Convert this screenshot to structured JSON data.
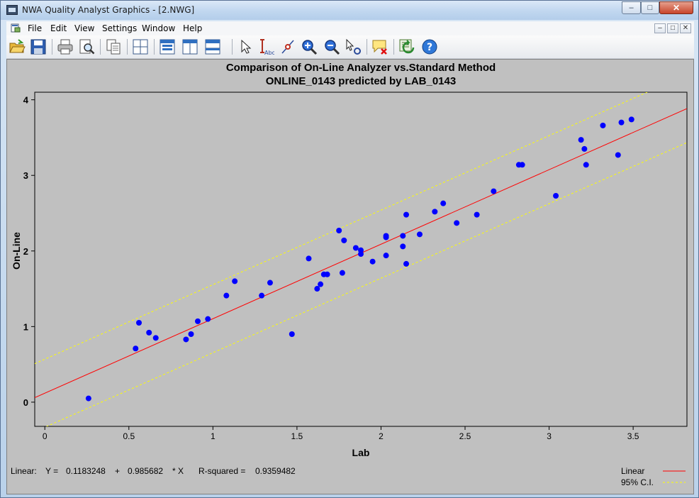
{
  "window": {
    "title": "NWA Quality Analyst Graphics - [2.NWG]",
    "buttons": {
      "minimize": "–",
      "maximize": "□",
      "close": "✕"
    }
  },
  "menu": {
    "items": [
      "File",
      "Edit",
      "View",
      "Settings",
      "Window",
      "Help"
    ],
    "mdi_buttons": [
      "–",
      "□",
      "✕"
    ]
  },
  "toolbar": {
    "icons": [
      "open-icon",
      "save-icon",
      "print-icon",
      "print-preview-icon",
      "copy-icon",
      "grid-layout-icon",
      "panes-layout-icon",
      "columns-layout-icon",
      "rows-layout-icon",
      "select-arrow-icon",
      "text-tool-icon",
      "point-marker-icon",
      "zoom-in-icon",
      "zoom-out-icon",
      "point-select-icon",
      "delete-annotation-icon",
      "refresh-icon",
      "help-icon"
    ]
  },
  "colors": {
    "plot_background": "#c0c0c0",
    "points": "#0000ff",
    "fit_line": "#ff0000",
    "ci_line": "#ffff00"
  },
  "chart_data": {
    "type": "scatter",
    "title": "Comparison of On-Line Analyzer vs.Standard Method",
    "subtitle": "ONLINE_0143 predicted by LAB_0143",
    "xlabel": "Lab",
    "ylabel": "On-Line",
    "xlim": [
      -0.06,
      3.82
    ],
    "ylim": [
      -0.32,
      4.1
    ],
    "xticks": [
      0,
      0.5,
      1,
      1.5,
      2,
      2.5,
      3,
      3.5
    ],
    "yticks": [
      0,
      1,
      2,
      3,
      4
    ],
    "grid": false,
    "points": [
      [
        0.26,
        0.05
      ],
      [
        0.54,
        0.71
      ],
      [
        0.56,
        1.05
      ],
      [
        0.62,
        0.92
      ],
      [
        0.66,
        0.85
      ],
      [
        0.84,
        0.83
      ],
      [
        0.87,
        0.9
      ],
      [
        0.91,
        1.07
      ],
      [
        0.97,
        1.1
      ],
      [
        1.08,
        1.41
      ],
      [
        1.13,
        1.6
      ],
      [
        1.29,
        1.41
      ],
      [
        1.34,
        1.58
      ],
      [
        1.47,
        0.9
      ],
      [
        1.57,
        1.9
      ],
      [
        1.62,
        1.5
      ],
      [
        1.64,
        1.56
      ],
      [
        1.66,
        1.69
      ],
      [
        1.68,
        1.69
      ],
      [
        1.75,
        2.27
      ],
      [
        1.77,
        1.71
      ],
      [
        1.78,
        2.14
      ],
      [
        1.85,
        2.04
      ],
      [
        1.88,
        2.01
      ],
      [
        1.88,
        1.96
      ],
      [
        1.95,
        1.86
      ],
      [
        2.03,
        2.18
      ],
      [
        2.03,
        2.2
      ],
      [
        2.03,
        1.94
      ],
      [
        2.13,
        2.2
      ],
      [
        2.13,
        2.06
      ],
      [
        2.15,
        1.83
      ],
      [
        2.15,
        2.48
      ],
      [
        2.23,
        2.22
      ],
      [
        2.32,
        2.52
      ],
      [
        2.37,
        2.63
      ],
      [
        2.45,
        2.37
      ],
      [
        2.57,
        2.48
      ],
      [
        2.67,
        2.79
      ],
      [
        2.82,
        3.14
      ],
      [
        2.84,
        3.14
      ],
      [
        3.04,
        2.73
      ],
      [
        3.19,
        3.47
      ],
      [
        3.21,
        3.35
      ],
      [
        3.22,
        3.14
      ],
      [
        3.32,
        3.66
      ],
      [
        3.41,
        3.27
      ],
      [
        3.43,
        3.7
      ],
      [
        3.49,
        3.74
      ]
    ],
    "fit": {
      "intercept": 0.1183248,
      "slope": 0.985682
    },
    "ci": {
      "upper_offset": 0.45,
      "lower_offset": -0.45
    },
    "stats": {
      "label": "Linear:",
      "y_eq": "Y =",
      "intercept_text": "0.1183248",
      "plus": "+",
      "slope_text": "0.985682",
      "times_x": "* X",
      "r2_label": "R-squared =",
      "r2_value": "0.9359482"
    },
    "legend": [
      {
        "name": "Linear",
        "color": "#ff0000",
        "dash": false
      },
      {
        "name": "95% C.I.",
        "color": "#ffff00",
        "dash": true
      }
    ]
  }
}
